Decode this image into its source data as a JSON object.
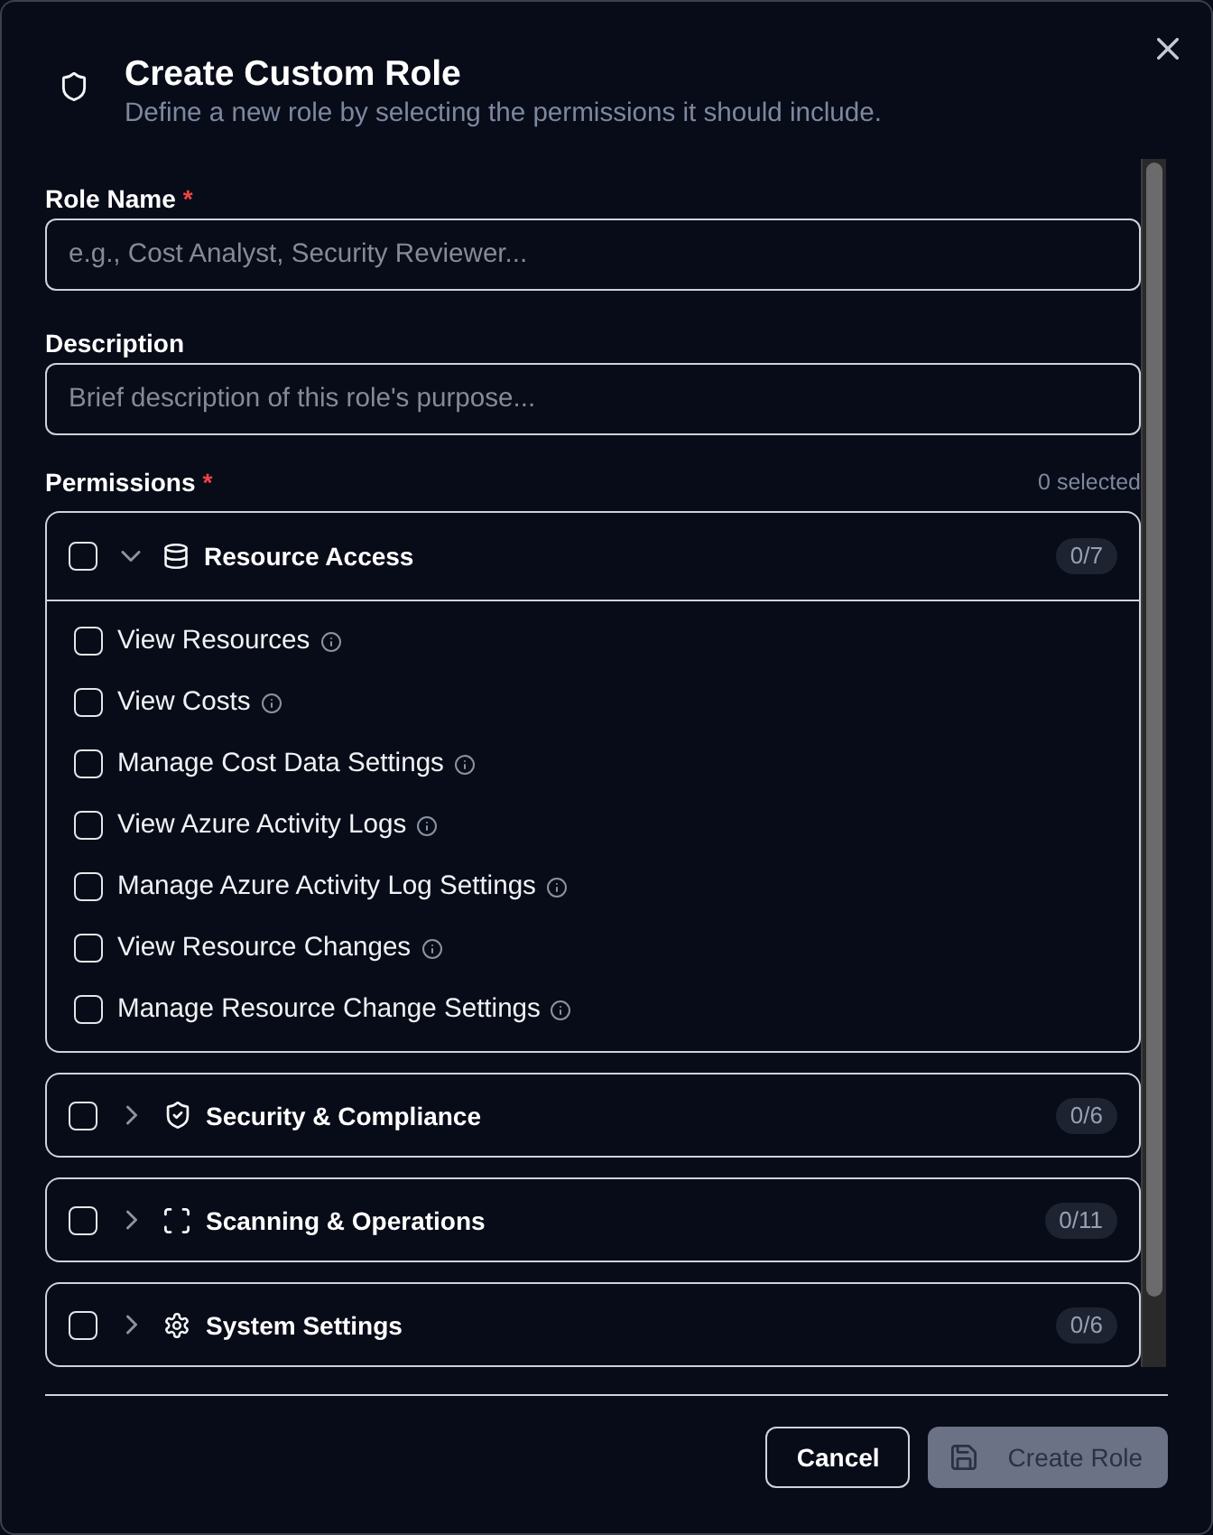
{
  "dialog": {
    "title": "Create Custom Role",
    "subtitle": "Define a new role by selecting the permissions it should include."
  },
  "fields": [
    {
      "label": "Role Name",
      "required_mark": "*",
      "placeholder": "e.g., Cost Analyst, Security Reviewer..."
    },
    {
      "label": "Description",
      "placeholder": "Brief description of this role's purpose..."
    }
  ],
  "permissions": {
    "label": "Permissions",
    "required_mark": "*",
    "selected_count": "0 selected",
    "groups": [
      {
        "label": "Resource Access",
        "count": "0/7",
        "checked": false,
        "expanded": true,
        "items": [
          {
            "label": "View Resources",
            "checked": false
          },
          {
            "label": "View Costs",
            "checked": false
          },
          {
            "label": "Manage Cost Data Settings",
            "checked": false
          },
          {
            "label": "View Azure Activity Logs",
            "checked": false
          },
          {
            "label": "Manage Azure Activity Log Settings",
            "checked": false
          },
          {
            "label": "View Resource Changes",
            "checked": false
          },
          {
            "label": "Manage Resource Change Settings",
            "checked": false
          }
        ]
      },
      {
        "label": "Security & Compliance",
        "count": "0/6",
        "checked": false,
        "expanded": false
      },
      {
        "label": "Scanning & Operations",
        "count": "0/11",
        "checked": false,
        "expanded": false
      },
      {
        "label": "System Settings",
        "count": "0/6",
        "checked": false,
        "expanded": false
      }
    ]
  },
  "footer": {
    "buttons": [
      {
        "label": "Cancel",
        "kind": "secondary",
        "disabled": false
      },
      {
        "label": "Create Role",
        "kind": "primary",
        "disabled": true
      }
    ]
  }
}
